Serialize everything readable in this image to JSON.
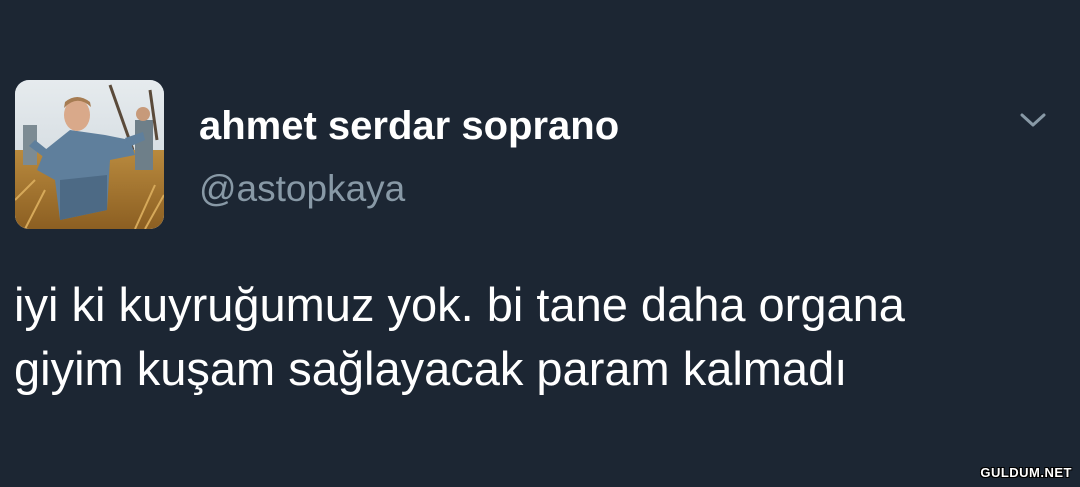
{
  "tweet": {
    "display_name": "ahmet serdar soprano",
    "handle": "@astopkaya",
    "text_lines": [
      "iyi ki kuyruğumuz yok. bi tane daha organa",
      "giyim kuşam sağlayacak param kalmadı"
    ],
    "avatar_icon": "profile-photo",
    "menu_icon": "chevron-down-icon"
  },
  "watermark": "GULDUM.NET",
  "colors": {
    "background": "#1c2633",
    "name": "#ffffff",
    "handle": "#8899a6",
    "text": "#ffffff",
    "chevron": "#8899a6"
  }
}
